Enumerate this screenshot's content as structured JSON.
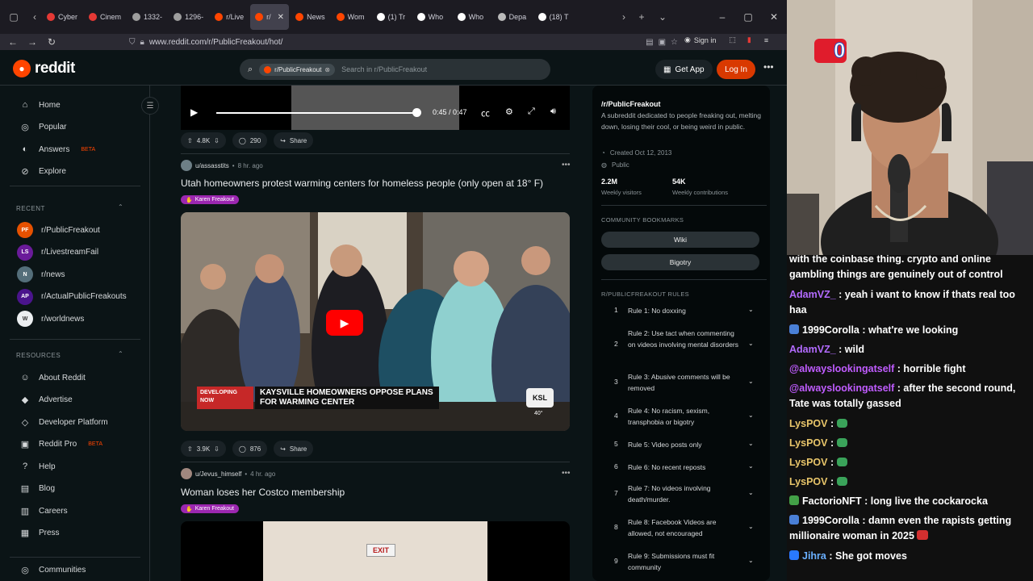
{
  "browser": {
    "tabs": [
      {
        "label": "Cyber",
        "color": "#e53935",
        "active": false
      },
      {
        "label": "Cinem",
        "color": "#e53935",
        "active": false
      },
      {
        "label": "1332-",
        "color": "#9e9e9e",
        "active": false
      },
      {
        "label": "1296-",
        "color": "#9e9e9e",
        "active": false
      },
      {
        "label": "r/Live",
        "color": "#ff4500",
        "active": false
      },
      {
        "label": "r/",
        "color": "#ff4500",
        "active": true
      },
      {
        "label": "News",
        "color": "#ff4500",
        "active": false
      },
      {
        "label": "Wom",
        "color": "#ff4500",
        "active": false
      },
      {
        "label": "(1) Tr",
        "color": "#ffffff",
        "active": false
      },
      {
        "label": "Who",
        "color": "#ffffff",
        "active": false
      },
      {
        "label": "Who",
        "color": "#ffffff",
        "active": false
      },
      {
        "label": "Depa",
        "color": "#bbbbbb",
        "active": false
      },
      {
        "label": "(18) T",
        "color": "#ffffff",
        "active": false
      }
    ],
    "url": "www.reddit.com/r/PublicFreakout/hot/",
    "sign_in": "Sign in"
  },
  "header": {
    "logo_text": "reddit",
    "search_chip": "r/PublicFreakout",
    "search_placeholder": "Search in r/PublicFreakout",
    "get_app": "Get App",
    "log_in": "Log In"
  },
  "left_nav": {
    "main": [
      {
        "label": "Home",
        "icon": "home-icon",
        "glyph": "⌂"
      },
      {
        "label": "Popular",
        "icon": "popular-icon",
        "glyph": "◎"
      },
      {
        "label": "Answers",
        "icon": "answers-icon",
        "glyph": "◐",
        "badge": "BETA"
      },
      {
        "label": "Explore",
        "icon": "explore-icon",
        "glyph": "⊘"
      }
    ],
    "recent_header": "RECENT",
    "recent": [
      {
        "label": "r/PublicFreakout",
        "color": "#e65100",
        "glyph": "PF"
      },
      {
        "label": "r/LivestreamFail",
        "color": "#6a1b9a",
        "glyph": "LS"
      },
      {
        "label": "r/news",
        "color": "#546e7a",
        "glyph": "N"
      },
      {
        "label": "r/ActualPublicFreakouts",
        "color": "#4a148c",
        "glyph": "AP"
      },
      {
        "label": "r/worldnews",
        "color": "#eceff1",
        "glyph": "W"
      }
    ],
    "resources_header": "RESOURCES",
    "resources": [
      {
        "label": "About Reddit",
        "icon": "reddit-icon",
        "glyph": "☺"
      },
      {
        "label": "Advertise",
        "icon": "megaphone-icon",
        "glyph": "◆"
      },
      {
        "label": "Developer Platform",
        "icon": "developer-icon",
        "glyph": "◇"
      },
      {
        "label": "Reddit Pro",
        "icon": "pro-icon",
        "glyph": "▣",
        "badge": "BETA"
      },
      {
        "label": "Help",
        "icon": "help-icon",
        "glyph": "?"
      },
      {
        "label": "Blog",
        "icon": "blog-icon",
        "glyph": "▤"
      },
      {
        "label": "Careers",
        "icon": "careers-icon",
        "glyph": "▥"
      },
      {
        "label": "Press",
        "icon": "press-icon",
        "glyph": "▦"
      }
    ],
    "communities": "Communities"
  },
  "feed": {
    "top_video": {
      "time": "0:45 / 0:47"
    },
    "post1_actions": {
      "votes": "4.8K",
      "comments": "290",
      "share": "Share"
    },
    "post2": {
      "user": "u/assasstits",
      "age": "8 hr. ago",
      "title": "Utah homeowners protest warming centers for homeless people (only open at 18° F)",
      "flair": "Karen Freakout",
      "banner_left": "DEVELOPING NOW",
      "banner_right": "KAYSVILLE HOMEOWNERS OPPOSE PLANS FOR WARMING CENTER",
      "station": "KSL",
      "temp": "40°",
      "votes": "3.9K",
      "comments": "876",
      "share": "Share"
    },
    "post3": {
      "user": "u/Jevus_himself",
      "age": "4 hr. ago",
      "title": "Woman loses her Costco membership",
      "flair": "Karen Freakout",
      "sign": "EXIT"
    }
  },
  "sidebar": {
    "sub_name": "/r/PublicFreakout",
    "description": "A subreddit dedicated to people freaking out, melting down, losing their cool, or being weird in public.",
    "created": "Created Oct 12, 2013",
    "visibility": "Public",
    "visitors_value": "2.2M",
    "visitors_label": "Weekly visitors",
    "contrib_value": "54K",
    "contrib_label": "Weekly contributions",
    "bookmarks_header": "COMMUNITY BOOKMARKS",
    "bookmarks": [
      "Wiki",
      "Bigotry"
    ],
    "rules_header": "R/PUBLICFREAKOUT RULES",
    "rules": [
      {
        "num": "1",
        "text": "Rule 1: No doxxing"
      },
      {
        "num": "2",
        "text": "Rule 2: Use tact when commenting on videos involving mental disorders"
      },
      {
        "num": "3",
        "text": "Rule 3: Abusive comments will be removed"
      },
      {
        "num": "4",
        "text": "Rule 4: No racism, sexism, transphobia or bigotry"
      },
      {
        "num": "5",
        "text": "Rule 5: Video posts only"
      },
      {
        "num": "6",
        "text": "Rule 6: No recent reposts"
      },
      {
        "num": "7",
        "text": "Rule 7: No videos involving death/murder."
      },
      {
        "num": "8",
        "text": "Rule 8: Facebook Videos are allowed, not encouraged"
      },
      {
        "num": "9",
        "text": "Rule 9: Submissions must fit community"
      }
    ]
  },
  "stream": {
    "overlay_count": "0",
    "chat": [
      {
        "user": "",
        "color": "#ffffff",
        "text": "with the coinbase thing. crypto and online gambling things are genuinely out of control",
        "badge": ""
      },
      {
        "user": "AdamVZ_",
        "color": "#b36bff",
        "text": "yeah i want to know if thats real too haa",
        "badge": ""
      },
      {
        "user": "1999Corolla",
        "color": "#ffffff",
        "text": "what're we looking",
        "badge": "#4a7fd6"
      },
      {
        "user": "AdamVZ_",
        "color": "#b36bff",
        "text": "wild",
        "badge": ""
      },
      {
        "user": "@alwayslookingatself",
        "color": "#c05cff",
        "text": "horrible fight",
        "badge": ""
      },
      {
        "user": "@alwayslookingatself",
        "color": "#c05cff",
        "text": "after the second round, Tate was totally gassed",
        "badge": ""
      },
      {
        "user": "LysPOV",
        "color": "#e8c56a",
        "text": "",
        "badge": "",
        "emote": "green"
      },
      {
        "user": "LysPOV",
        "color": "#e8c56a",
        "text": "",
        "badge": "",
        "emote": "green"
      },
      {
        "user": "LysPOV",
        "color": "#e8c56a",
        "text": "",
        "badge": "",
        "emote": "green"
      },
      {
        "user": "LysPOV",
        "color": "#e8c56a",
        "text": "",
        "badge": "",
        "emote": "green"
      },
      {
        "user": "FactorioNFT",
        "color": "#ffffff",
        "text": "long live the cockarocka",
        "badge": "#43a047"
      },
      {
        "user": "1999Corolla",
        "color": "#ffffff",
        "text": "damn even the rapists getting millionaire woman in 2025",
        "badge": "#4a7fd6",
        "emote": "red"
      },
      {
        "user": "Jihra",
        "color": "#6ab0ff",
        "text": "She got moves",
        "badge": "#2979ff"
      }
    ]
  }
}
